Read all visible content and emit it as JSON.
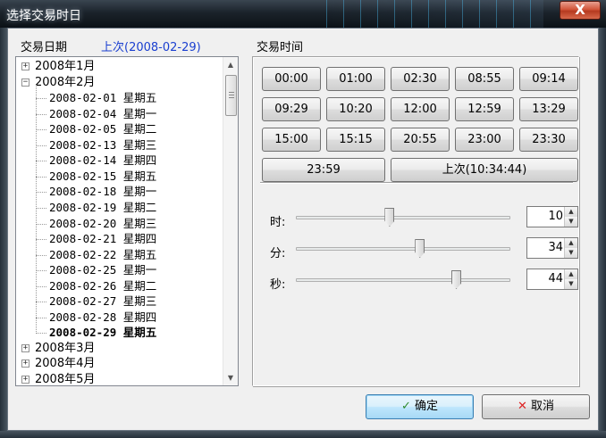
{
  "window": {
    "title": "选择交易时日",
    "close_glyph": "X"
  },
  "left": {
    "heading": "交易日期",
    "last_link": "上次(2008-02-29)"
  },
  "tree": {
    "collapsed_years_before": [
      {
        "label": "2008年1月",
        "expander": "+"
      }
    ],
    "open_month": {
      "label": "2008年2月",
      "expander": "−"
    },
    "days": [
      {
        "label": "2008-02-01 星期五"
      },
      {
        "label": "2008-02-04 星期一"
      },
      {
        "label": "2008-02-05 星期二"
      },
      {
        "label": "2008-02-13 星期三"
      },
      {
        "label": "2008-02-14 星期四"
      },
      {
        "label": "2008-02-15 星期五"
      },
      {
        "label": "2008-02-18 星期一"
      },
      {
        "label": "2008-02-19 星期二"
      },
      {
        "label": "2008-02-20 星期三"
      },
      {
        "label": "2008-02-21 星期四"
      },
      {
        "label": "2008-02-22 星期五"
      },
      {
        "label": "2008-02-25 星期一"
      },
      {
        "label": "2008-02-26 星期二"
      },
      {
        "label": "2008-02-27 星期三"
      },
      {
        "label": "2008-02-28 星期四"
      },
      {
        "label": "2008-02-29 星期五",
        "selected": true
      }
    ],
    "collapsed_years_after": [
      {
        "label": "2008年3月",
        "expander": "+"
      },
      {
        "label": "2008年4月",
        "expander": "+"
      },
      {
        "label": "2008年5月",
        "expander": "+"
      }
    ]
  },
  "right": {
    "heading": "交易时间",
    "time_buttons": [
      "00:00",
      "01:00",
      "02:30",
      "08:55",
      "09:14",
      "09:29",
      "10:20",
      "12:00",
      "12:59",
      "13:29",
      "15:00",
      "15:15",
      "20:55",
      "23:00",
      "23:30",
      "23:59"
    ],
    "last_time_button": "上次(10:34:44)",
    "sliders": [
      {
        "label": "时:",
        "value": "10",
        "level_fraction": 0.435
      },
      {
        "label": "分:",
        "value": "34",
        "level_fraction": 0.576
      },
      {
        "label": "秒:",
        "value": "44",
        "level_fraction": 0.746
      }
    ]
  },
  "buttons": {
    "ok": "确定",
    "cancel": "取消"
  },
  "colors": {
    "link": "#1a3fd0",
    "accent_default_button": "#3c7fb1"
  }
}
